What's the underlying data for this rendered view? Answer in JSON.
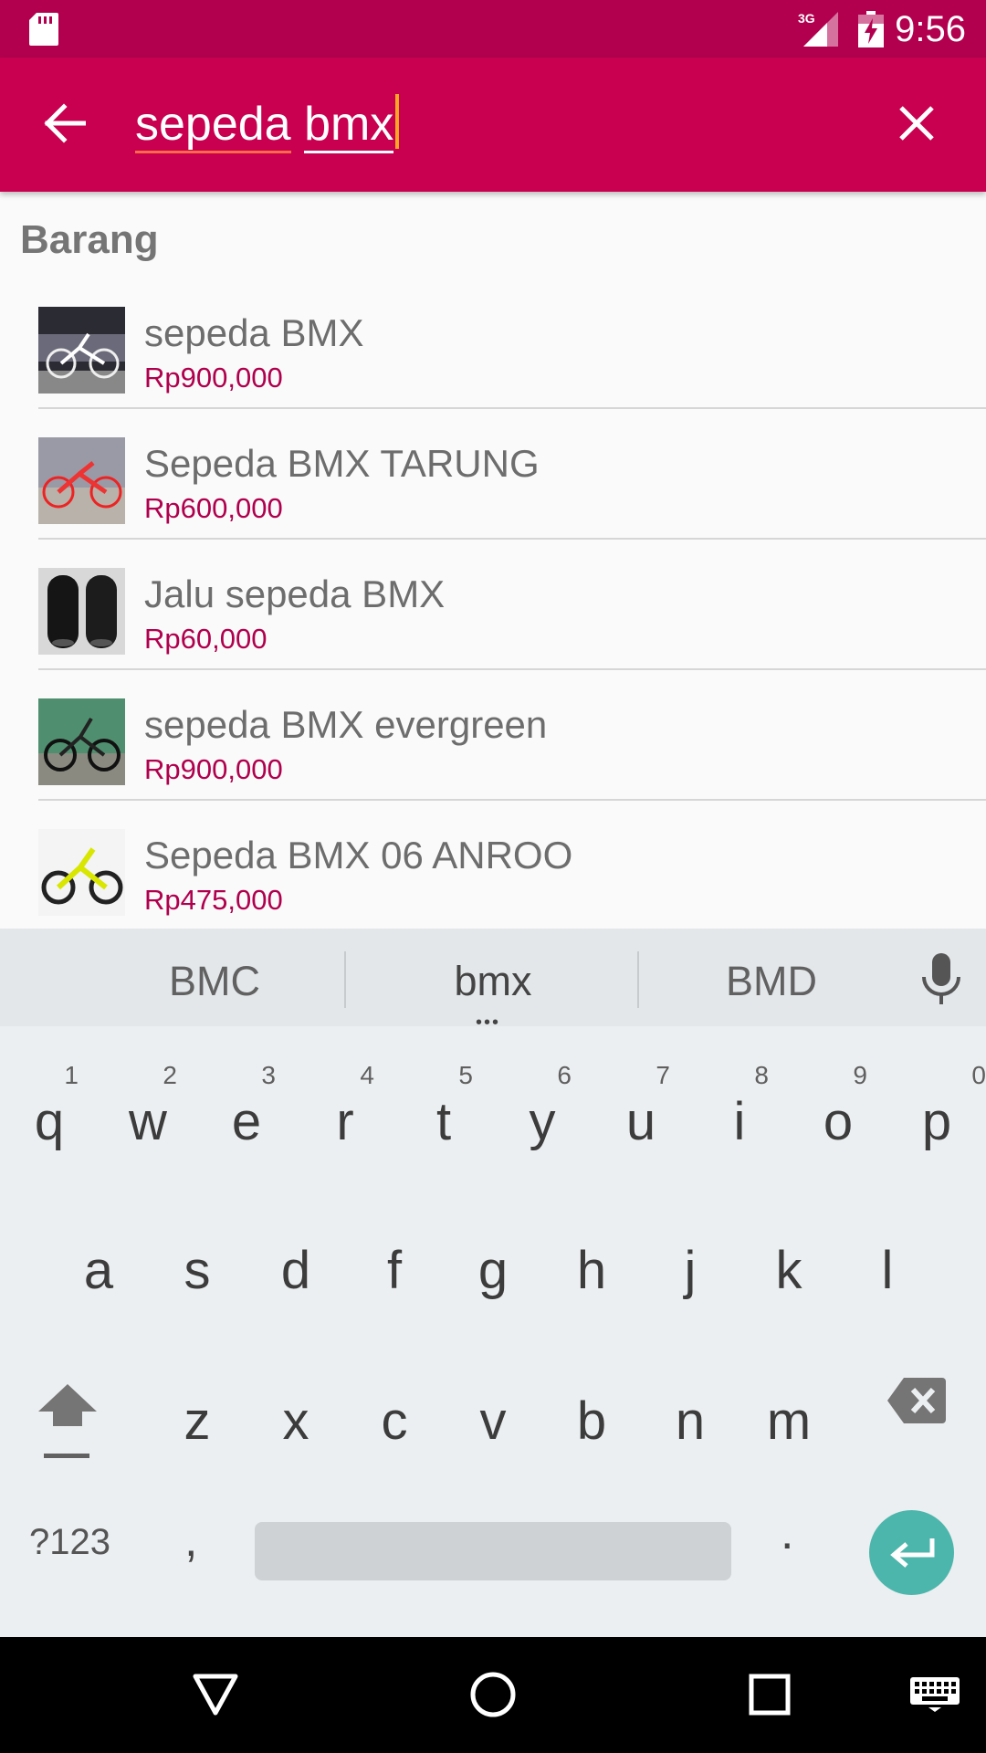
{
  "status_bar": {
    "time": "9:56",
    "network": "3G"
  },
  "search": {
    "query_word1": "sepeda",
    "query_word2": "bmx"
  },
  "results": {
    "section_title": "Barang",
    "items": [
      {
        "name": "sepeda BMX",
        "price": "Rp900,000"
      },
      {
        "name": "Sepeda BMX TARUNG",
        "price": "Rp600,000"
      },
      {
        "name": "Jalu sepeda BMX",
        "price": "Rp60,000"
      },
      {
        "name": "sepeda BMX evergreen",
        "price": "Rp900,000"
      },
      {
        "name": "Sepeda BMX 06 ANROO",
        "price": "Rp475,000"
      }
    ]
  },
  "keyboard": {
    "suggestions": [
      "BMC",
      "bmx",
      "BMD"
    ],
    "row1": [
      {
        "k": "q",
        "h": "1"
      },
      {
        "k": "w",
        "h": "2"
      },
      {
        "k": "e",
        "h": "3"
      },
      {
        "k": "r",
        "h": "4"
      },
      {
        "k": "t",
        "h": "5"
      },
      {
        "k": "y",
        "h": "6"
      },
      {
        "k": "u",
        "h": "7"
      },
      {
        "k": "i",
        "h": "8"
      },
      {
        "k": "o",
        "h": "9"
      },
      {
        "k": "p",
        "h": "0"
      }
    ],
    "row2": [
      "a",
      "s",
      "d",
      "f",
      "g",
      "h",
      "j",
      "k",
      "l"
    ],
    "row3": [
      "z",
      "x",
      "c",
      "v",
      "b",
      "n",
      "m"
    ],
    "symbols_label": "?123",
    "comma": ",",
    "period": "."
  },
  "colors": {
    "app_bar": "#c8004f",
    "status_bar": "#b2004f",
    "price": "#b0004d",
    "enter": "#4db6ac"
  }
}
